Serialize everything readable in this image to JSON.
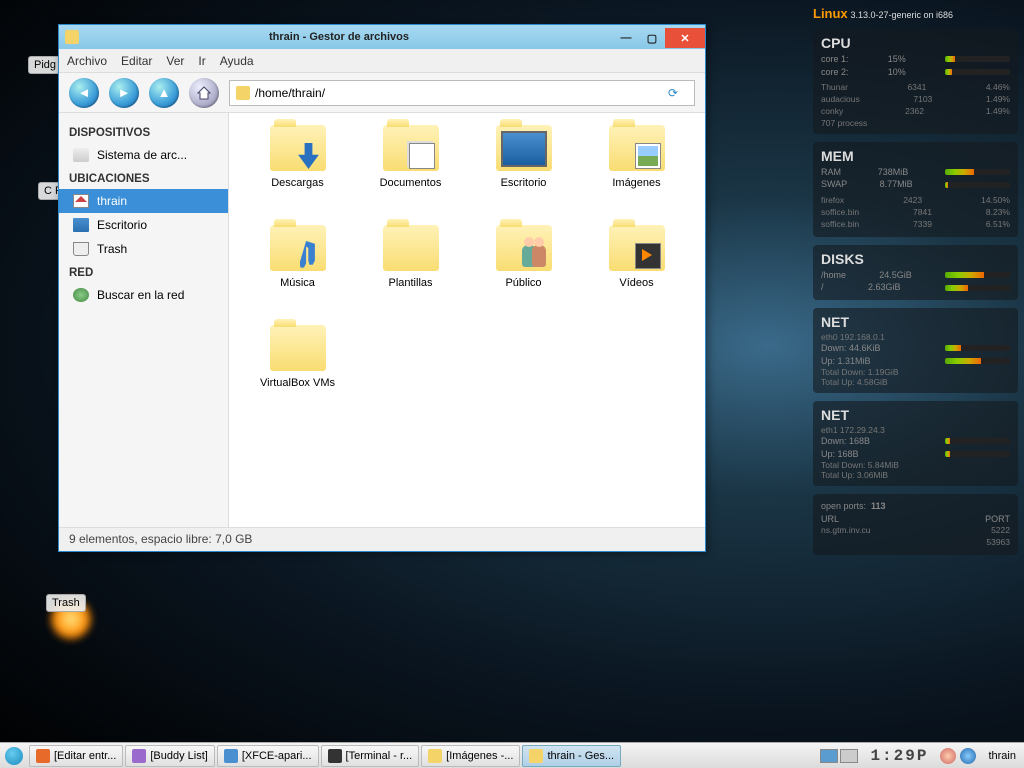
{
  "conky": {
    "os": "Linux",
    "kernel": "3.13.0-27-generic on i686",
    "cpu": {
      "title": "CPU",
      "cores": [
        {
          "label": "core 1:",
          "value": "15%",
          "pct": 15
        },
        {
          "label": "core 2:",
          "value": "10%",
          "pct": 10
        }
      ],
      "procs": [
        {
          "name": "Thunar",
          "pid": "6341",
          "pct": "4.46%"
        },
        {
          "name": "audacious",
          "pid": "7103",
          "pct": "1.49%"
        },
        {
          "name": "conky",
          "pid": "2362",
          "pct": "1.49%"
        }
      ],
      "total": "707 process"
    },
    "mem": {
      "title": "MEM",
      "rows": [
        {
          "label": "RAM",
          "value": "738MiB",
          "pct": 45
        },
        {
          "label": "SWAP",
          "value": "8.77MiB",
          "pct": 5
        }
      ],
      "procs": [
        {
          "name": "firefox",
          "pid": "2423",
          "pct": "14.50%"
        },
        {
          "name": "soffice.bin",
          "pid": "7841",
          "pct": "8.23%"
        },
        {
          "name": "soffice.bin",
          "pid": "7339",
          "pct": "6.51%"
        }
      ]
    },
    "disks": {
      "title": "DISKS",
      "rows": [
        {
          "label": "/home",
          "value": "24.5GiB",
          "pct": 60
        },
        {
          "label": "/",
          "value": "2.63GiB",
          "pct": 35
        }
      ]
    },
    "net0": {
      "title": "NET",
      "iface": "eth0 192.168.0.1",
      "down": "Down: 44.6KiB",
      "up": "Up: 1.31MiB",
      "tdown": "Total Down: 1.19GiB",
      "tup": "Total Up: 4.58GiB"
    },
    "net1": {
      "title": "NET",
      "iface": "eth1 172.29.24.3",
      "down": "Down: 168B",
      "up": "Up: 168B",
      "tdown": "Total Down: 5.84MiB",
      "tup": "Total Up: 3.06MiB"
    },
    "ports": {
      "label": "open ports:",
      "count": "113",
      "url_header": "URL",
      "port_header": "PORT",
      "entries": [
        {
          "url": "ns.gtm.inv.cu",
          "port": "5222"
        },
        {
          "url": "",
          "port": "53963"
        }
      ]
    }
  },
  "desktop_icons": {
    "pidgin": "Pidg\nInte",
    "c": "C\nPo",
    "trash": "Trash"
  },
  "fm": {
    "title": "thrain - Gestor de archivos",
    "menu": [
      "Archivo",
      "Editar",
      "Ver",
      "Ir",
      "Ayuda"
    ],
    "path": "/home/thrain/",
    "sidebar": {
      "devices_header": "DISPOSITIVOS",
      "devices": [
        {
          "label": "Sistema de arc...",
          "icon": "drive"
        }
      ],
      "places_header": "UBICACIONES",
      "places": [
        {
          "label": "thrain",
          "icon": "home",
          "selected": true
        },
        {
          "label": "Escritorio",
          "icon": "desktop"
        },
        {
          "label": "Trash",
          "icon": "trash"
        }
      ],
      "network_header": "RED",
      "network": [
        {
          "label": "Buscar en la red",
          "icon": "net"
        }
      ]
    },
    "folders": [
      {
        "name": "Descargas",
        "overlay": "dl"
      },
      {
        "name": "Documentos",
        "overlay": "doc"
      },
      {
        "name": "Escritorio",
        "overlay": "screen"
      },
      {
        "name": "Imágenes",
        "overlay": "img"
      },
      {
        "name": "Música",
        "overlay": "music"
      },
      {
        "name": "Plantillas",
        "overlay": ""
      },
      {
        "name": "Público",
        "overlay": "people"
      },
      {
        "name": "Vídeos",
        "overlay": "video"
      },
      {
        "name": "VirtualBox VMs",
        "overlay": ""
      }
    ],
    "status": "9 elementos, espacio libre: 7,0 GB"
  },
  "taskbar": {
    "items": [
      {
        "label": "[Editar entr...",
        "color": "#e86a2a"
      },
      {
        "label": "[Buddy List]",
        "color": "#9a6acc"
      },
      {
        "label": "[XFCE-apari...",
        "color": "#4a90d0"
      },
      {
        "label": "[Terminal - r...",
        "color": "#333"
      },
      {
        "label": "[Imágenes -...",
        "color": "#f4d468"
      },
      {
        "label": "thrain - Ges...",
        "color": "#f4d468",
        "active": true
      }
    ],
    "clock": "1:29P",
    "user": "thrain"
  }
}
